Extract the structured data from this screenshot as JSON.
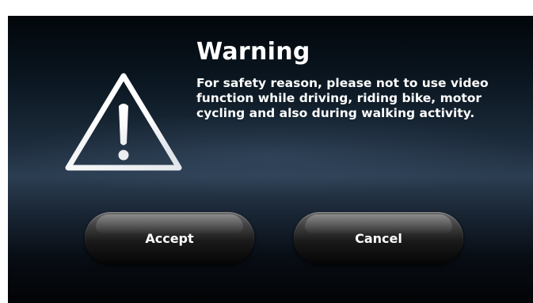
{
  "dialog": {
    "title": "Warning",
    "message": "For safety reason, please not to use video function while driving, riding bike, motor cycling and also during walking activity.",
    "icon": "warning-triangle-icon"
  },
  "buttons": {
    "accept_label": "Accept",
    "cancel_label": "Cancel"
  },
  "colors": {
    "text": "#ffffff",
    "background_dark": "#020305",
    "background_mid": "#2c3e52"
  }
}
